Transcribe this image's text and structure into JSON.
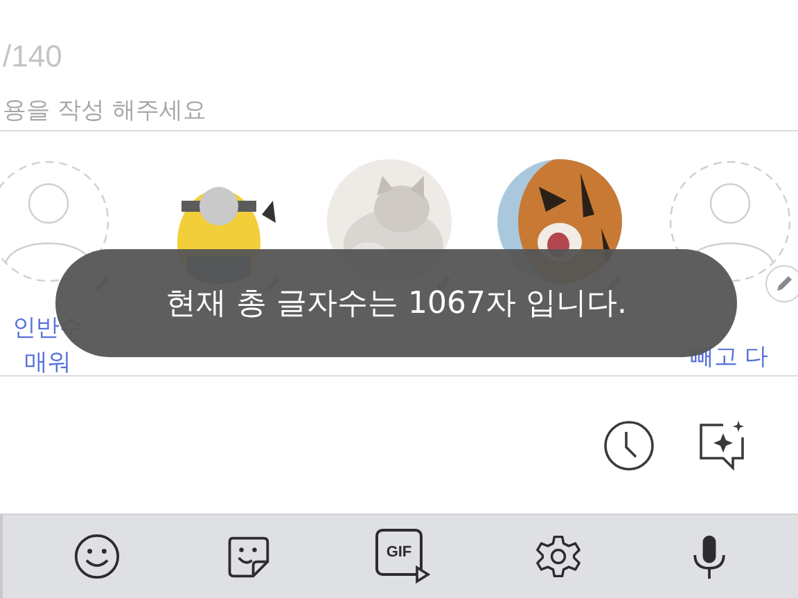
{
  "editor": {
    "char_count": "/140",
    "prompt": "용을 작성 해주세요"
  },
  "profiles": [
    {
      "kind": "empty",
      "label_lines": [
        "인반수",
        "매워"
      ]
    },
    {
      "kind": "picture"
    },
    {
      "kind": "picture"
    },
    {
      "kind": "picture"
    },
    {
      "kind": "empty",
      "label_lines": [
        "빼고 다"
      ]
    }
  ],
  "toast": {
    "message": "현재 총 글자수는 1067자 입니다."
  },
  "keyboard_bar": {
    "gif_label": "GIF"
  }
}
